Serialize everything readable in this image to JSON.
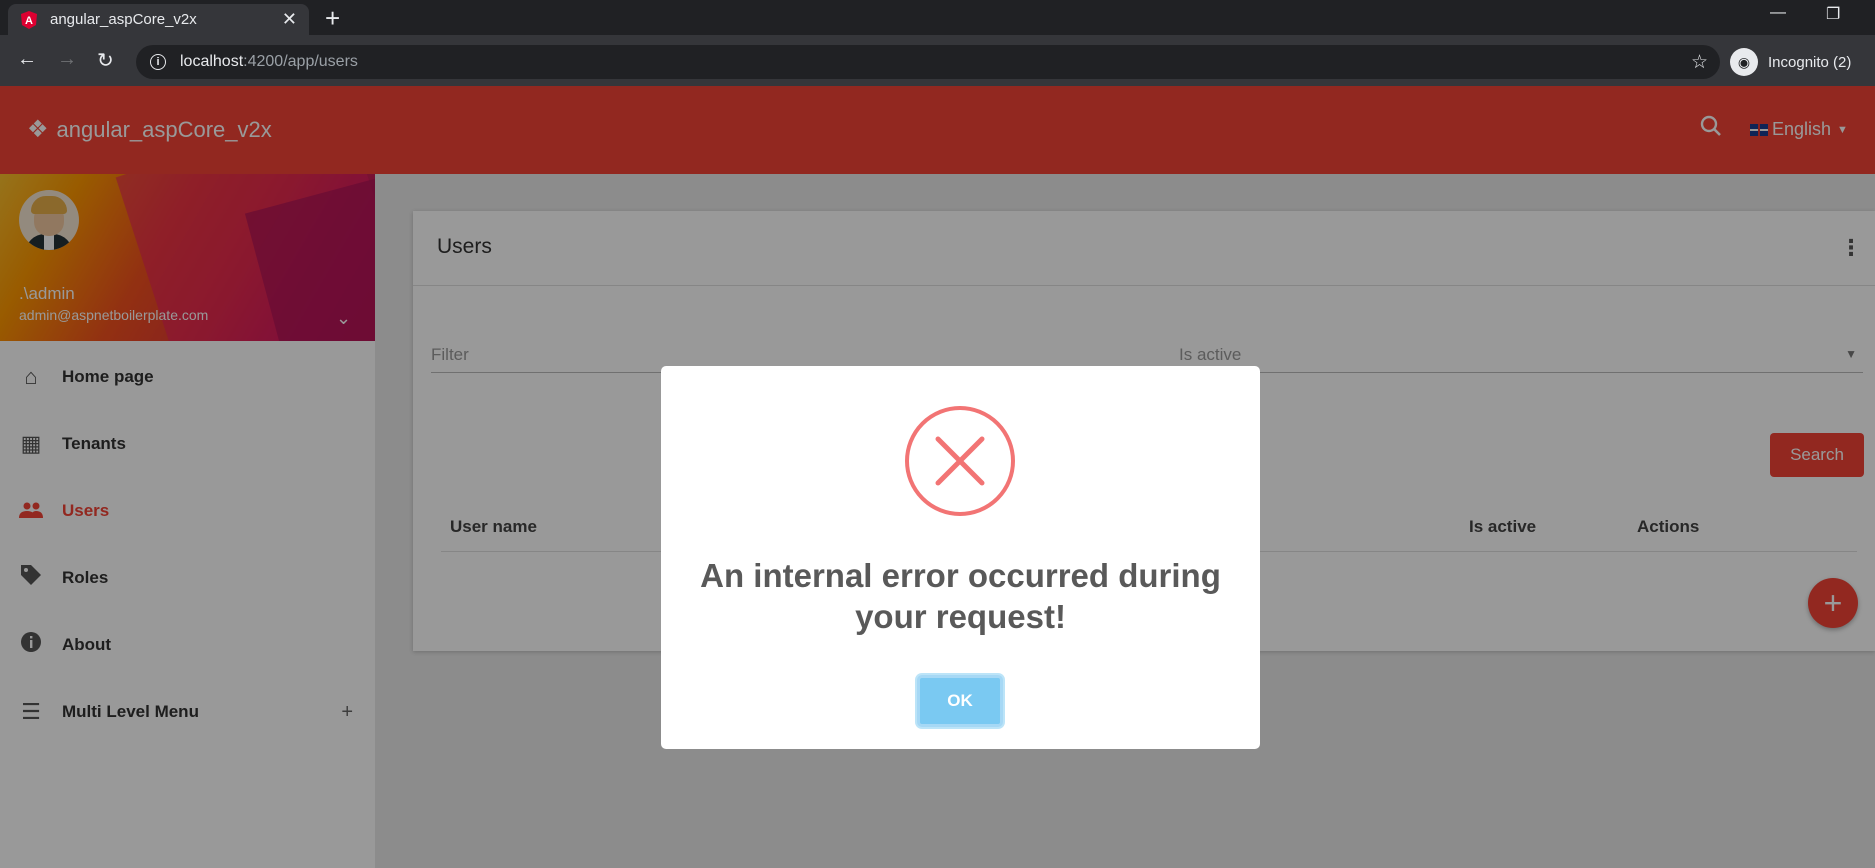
{
  "browser": {
    "tab_title": "angular_aspCore_v2x",
    "tab_close": "✕",
    "new_tab": "+",
    "url_host": "localhost",
    "url_rest": ":4200/app/users",
    "incognito_label": "Incognito (2)"
  },
  "header": {
    "brand": "angular_aspCore_v2x",
    "language": "English"
  },
  "user": {
    "name": ".\\admin",
    "email": "admin@aspnetboilerplate.com"
  },
  "menu": [
    {
      "label": "Home page",
      "icon": "home-icon"
    },
    {
      "label": "Tenants",
      "icon": "building-icon"
    },
    {
      "label": "Users",
      "icon": "people-icon",
      "active": true
    },
    {
      "label": "Roles",
      "icon": "tag-icon"
    },
    {
      "label": "About",
      "icon": "info-icon"
    },
    {
      "label": "Multi Level Menu",
      "icon": "menu-icon"
    }
  ],
  "users_card": {
    "title": "Users",
    "filter_placeholder": "Filter",
    "is_active_placeholder": "Is active",
    "search_button": "Search",
    "columns": [
      "User name",
      "Is active",
      "Actions"
    ]
  },
  "modal": {
    "title": "An internal error occurred during your request!",
    "ok_button": "OK"
  },
  "colors": {
    "primary": "#f44336",
    "error_icon": "#f27474",
    "ok_button": "#7ac9f2"
  }
}
